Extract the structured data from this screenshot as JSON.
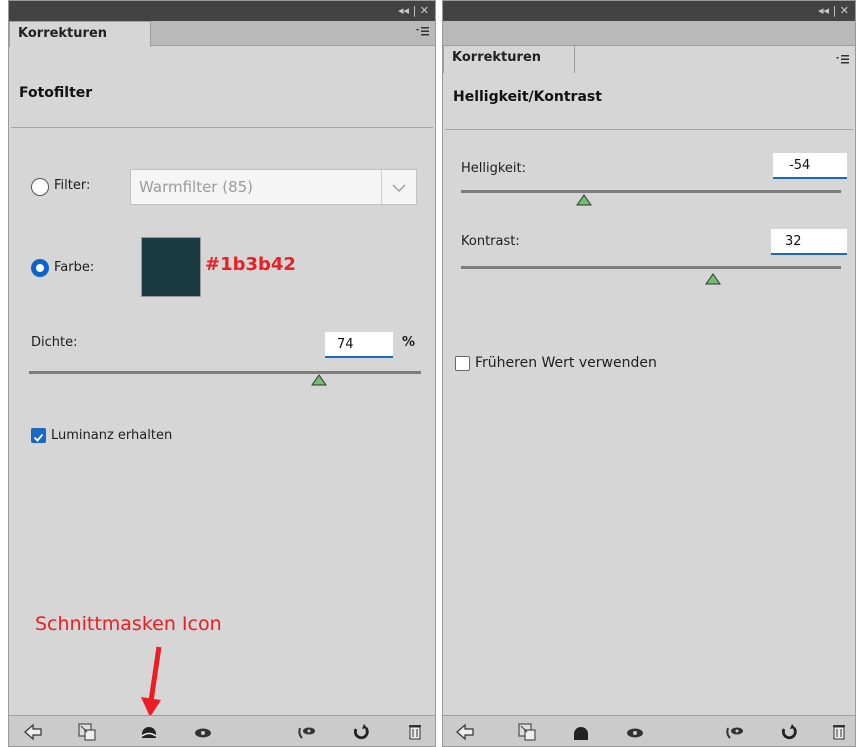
{
  "left_panel": {
    "tab_label": "Korrekturen",
    "title": "Fotofilter",
    "filter_label": "Filter:",
    "filter_value": "Warmfilter (85)",
    "color_label": "Farbe:",
    "color_swatch": "#1b3b42",
    "density_label": "Dichte:",
    "density_value": "74",
    "density_unit": "%",
    "density_fraction": 0.74,
    "preserve_label": "Luminanz erhalten",
    "preserve_checked": true
  },
  "right_panel": {
    "tab_label": "Korrekturen",
    "title": "Helligkeit/Kontrast",
    "brightness_label": "Helligkeit:",
    "brightness_value": "-54",
    "contrast_label": "Kontrast:",
    "contrast_value": "32",
    "legacy_label": "Früheren Wert verwenden",
    "legacy_checked": false
  },
  "annotations": {
    "hex_label": "#1b3b42",
    "icon_label": "Schnittmasken Icon",
    "color": "#ec1d24"
  },
  "icons": [
    "back-arrow-icon",
    "expand-view-icon",
    "clip-mask-icon",
    "visibility-eye-icon",
    "view-previous-icon",
    "reset-icon",
    "trash-icon"
  ]
}
